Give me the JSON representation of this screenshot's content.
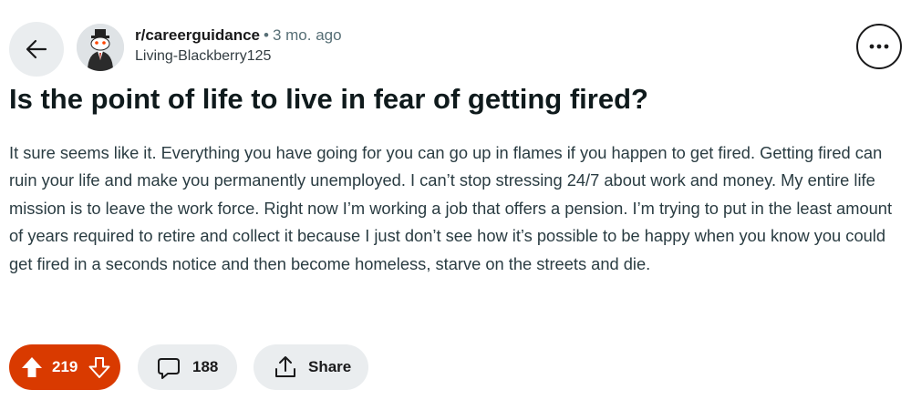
{
  "post": {
    "subreddit": "r/careerguidance",
    "separator": "•",
    "age": "3 mo. ago",
    "author": "Living-Blackberry125",
    "title": "Is the point of life to live in fear of getting fired?",
    "body": "It sure seems like it. Everything you have going for you can go up in flames if you happen to get fired. Getting fired can ruin your life and make you permanently unemployed. I can’t stop stressing 24/7 about work and money. My entire life mission is to leave the work force. Right now I’m working a job that offers a pension. I’m trying to put in the least amount of years required to retire and collect it because I just don’t see how it’s possible to be happy when you know you could get fired in a seconds notice and then become homeless, starve on the streets and die."
  },
  "actions": {
    "vote_count": "219",
    "comment_count": "188",
    "share_label": "Share"
  },
  "icons": {
    "back": "back-arrow-icon",
    "avatar": "subreddit-avatar-icon",
    "more": "more-options-icon",
    "upvote": "upvote-icon",
    "downvote": "downvote-icon",
    "comment": "comment-icon",
    "share": "share-icon"
  },
  "colors": {
    "vote_bg": "#d93a00",
    "pill_bg": "#eaedef",
    "text": "#1a1a1b",
    "muted": "#576f76"
  }
}
